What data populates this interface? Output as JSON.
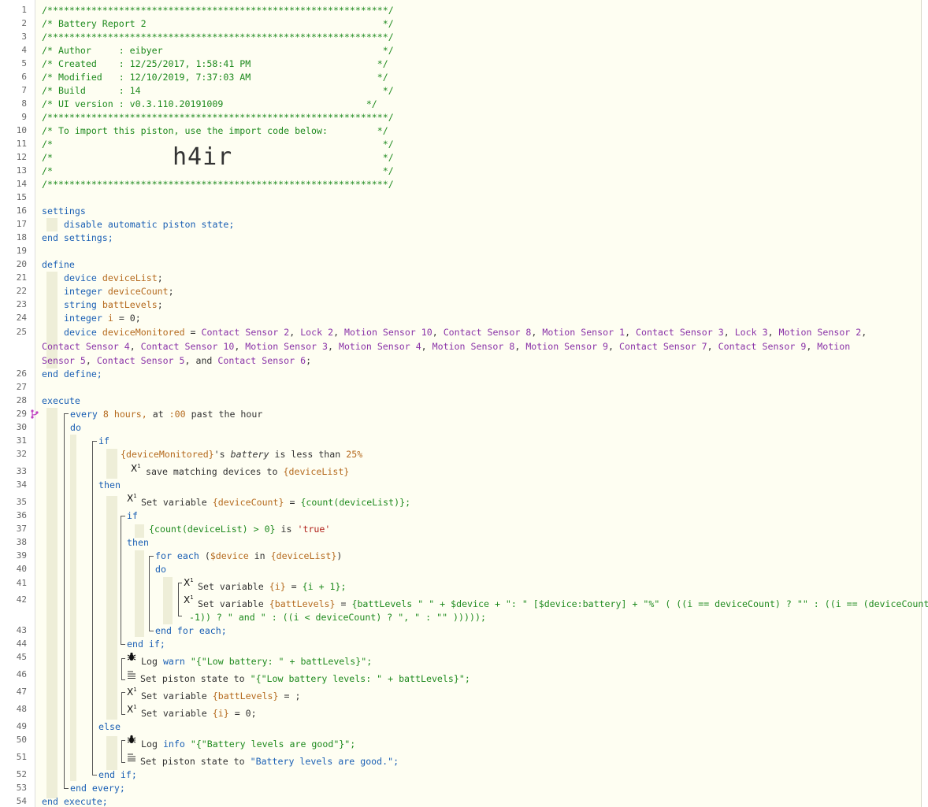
{
  "header": {
    "rule": "/**************************************************************/",
    "title": "/* Battery Report 2                                           */",
    "author": "/* Author     : eibyer                                        */",
    "created": "/* Created    : 12/25/2017, 1:58:41 PM                       */",
    "modified": "/* Modified   : 12/10/2019, 7:37:03 AM                       */",
    "build": "/* Build      : 14                                            */",
    "ui_version": "/* UI version : v0.3.110.20191009                          */",
    "import_note": "/* To import this piston, use the import code below:         */",
    "blank": "/*                                                            */",
    "import_code": "h4ir"
  },
  "line_numbers": [
    "1",
    "2",
    "3",
    "4",
    "5",
    "6",
    "7",
    "8",
    "9",
    "10",
    "11",
    "12",
    "13",
    "14",
    "15",
    "16",
    "17",
    "18",
    "19",
    "20",
    "21",
    "22",
    "23",
    "24",
    "25",
    "26",
    "27",
    "28",
    "29",
    "30",
    "31",
    "32",
    "33",
    "34",
    "35",
    "36",
    "37",
    "38",
    "39",
    "40",
    "41",
    "42",
    "43",
    "44",
    "45",
    "46",
    "47",
    "48",
    "49",
    "50",
    "51",
    "52",
    "53",
    "54"
  ],
  "settings": {
    "open": "settings",
    "body": "disable automatic piston state;",
    "close": "end settings;"
  },
  "define": {
    "open": "define",
    "vars": [
      {
        "type": "device",
        "name": "deviceList",
        "tail": ";"
      },
      {
        "type": "integer",
        "name": "deviceCount",
        "tail": ";"
      },
      {
        "type": "string",
        "name": "battLevels",
        "tail": ";"
      },
      {
        "type": "integer",
        "name": "i",
        "tail": " = 0;"
      }
    ],
    "monitored_type": "device",
    "monitored_name": "deviceMonitored",
    "devices": [
      "Contact Sensor 2",
      "Lock 2",
      "Motion Sensor 10",
      "Contact Sensor 8",
      "Motion Sensor 1",
      "Contact Sensor 3",
      "Lock 3",
      "Motion Sensor 2",
      "Contact Sensor 4",
      "Contact Sensor 10",
      "Motion Sensor 3",
      "Motion Sensor 4",
      "Motion Sensor 8",
      "Motion Sensor 9",
      "Contact Sensor 7",
      "Contact Sensor 9",
      "Motion",
      "Sensor 5",
      "Contact Sensor 5",
      "Contact Sensor 6"
    ],
    "close": "end define;"
  },
  "execute": {
    "open": "execute",
    "every": "every",
    "every_val": "8 hours,",
    "at": "at",
    "at_val": ":00",
    "past": "past the hour",
    "do": "do",
    "if": "if",
    "cond_var": "{deviceMonitored}",
    "cond_attr": "battery",
    "cond_op": "is less than",
    "cond_val": "25%",
    "save_text": "save matching devices to",
    "save_var": "{deviceList}",
    "then": "then",
    "set_variable": "Set variable",
    "dc_var": "{deviceCount}",
    "dc_expr": "{count(deviceList)};",
    "if2": "if",
    "cond2": "{count(deviceList) > 0}",
    "cond2_is": "is",
    "cond2_val": "'true'",
    "then2": "then",
    "foreach": "for each",
    "foreach_var": "$device",
    "foreach_in": "in",
    "foreach_list": "{deviceList}",
    "do2": "do",
    "i_var": "{i}",
    "i_expr": "{i + 1};",
    "bl_var": "{battLevels}",
    "bl_expr1": "{battLevels \" \" + $device + \": \" [$device:battery] + \"%\" ( ((i == deviceCount) ? \"\" : ((i == (deviceCount",
    "bl_expr2": "-1)) ? \" and \" : ((i < deviceCount) ? \", \" : \"\" )))));",
    "end_foreach": "end for each;",
    "end_if2": "end if;",
    "log": "Log",
    "log_warn": "warn",
    "log_warn_msg": "\"{\"Low battery: \" + battLevels}\";",
    "set_state": "Set piston state to",
    "state_low": "\"{\"Low battery levels: \" + battLevels}\";",
    "bl_reset": "= ;",
    "i_reset": "= 0;",
    "else": "else",
    "log_info": "info",
    "log_info_msg": "\"{\"Battery levels are good\"}\";",
    "state_good": "\"Battery levels are good.\";",
    "end_if": "end if;",
    "end_every": "end every;",
    "close": "end execute;"
  }
}
